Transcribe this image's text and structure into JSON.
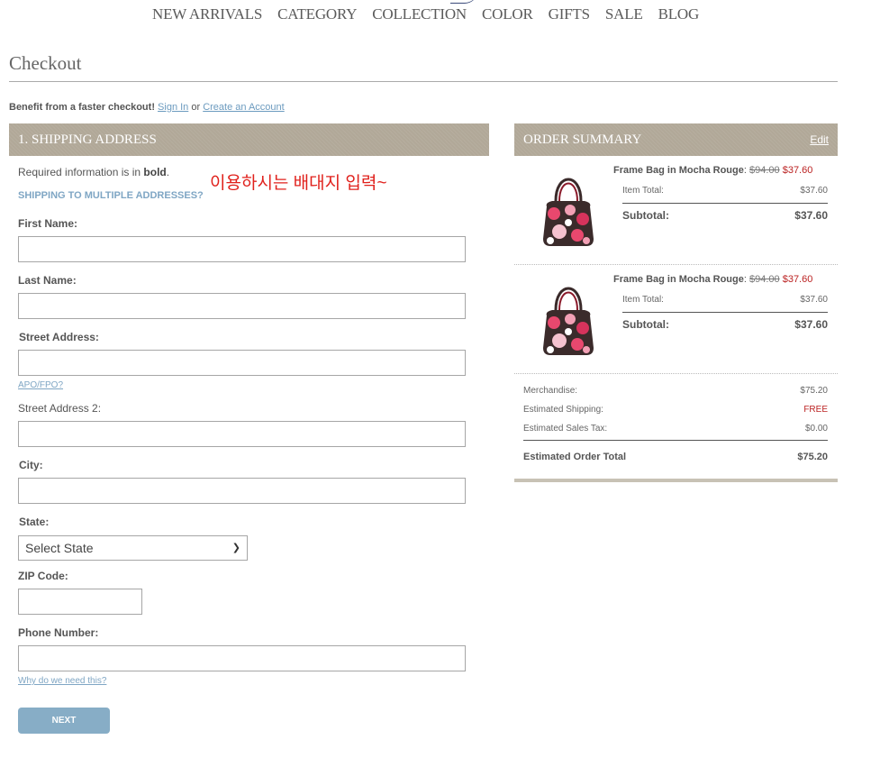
{
  "nav": [
    "NEW ARRIVALS",
    "CATEGORY",
    "COLLECTION",
    "COLOR",
    "GIFTS",
    "SALE",
    "BLOG"
  ],
  "page_title": "Checkout",
  "faster": {
    "text": "Benefit from a faster checkout!",
    "sign_in": "Sign In",
    "or": "or",
    "create": "Create an Account"
  },
  "shipping": {
    "header": "1. SHIPPING ADDRESS",
    "required_pre": "Required information is in",
    "required_bold": "bold",
    "required_post": ".",
    "multi": "SHIPPING TO MULTIPLE ADDRESSES?",
    "annotation": "이용하시는 배대지 입력~",
    "first_name": "First Name:",
    "last_name": "Last Name:",
    "street": "Street Address:",
    "apo": "APO/FPO?",
    "street2": "Street Address 2:",
    "city": "City:",
    "state": "State:",
    "state_value": "Select State",
    "zip": "ZIP Code:",
    "phone": "Phone Number:",
    "why": "Why do we need this?",
    "next": "NEXT"
  },
  "summary": {
    "header": "ORDER SUMMARY",
    "edit": "Edit",
    "items": [
      {
        "name": "Frame Bag in Mocha Rouge",
        "orig": "$94.00",
        "sale": "$37.60",
        "item_total_label": "Item Total:",
        "item_total": "$37.60",
        "subtotal_label": "Subtotal:",
        "subtotal": "$37.60"
      },
      {
        "name": "Frame Bag in Mocha Rouge",
        "orig": "$94.00",
        "sale": "$37.60",
        "item_total_label": "Item Total:",
        "item_total": "$37.60",
        "subtotal_label": "Subtotal:",
        "subtotal": "$37.60"
      }
    ],
    "merch_label": "Merchandise:",
    "merch": "$75.20",
    "ship_label": "Estimated Shipping:",
    "ship": "FREE",
    "tax_label": "Estimated Sales Tax:",
    "tax": "$0.00",
    "total_label": "Estimated Order Total",
    "total": "$75.20"
  },
  "colors": {
    "header_bg": "#b1a898",
    "link": "#7fa6c4",
    "sale_red": "#b22222",
    "annotation_red": "#e0211c",
    "button": "#87adc6"
  }
}
